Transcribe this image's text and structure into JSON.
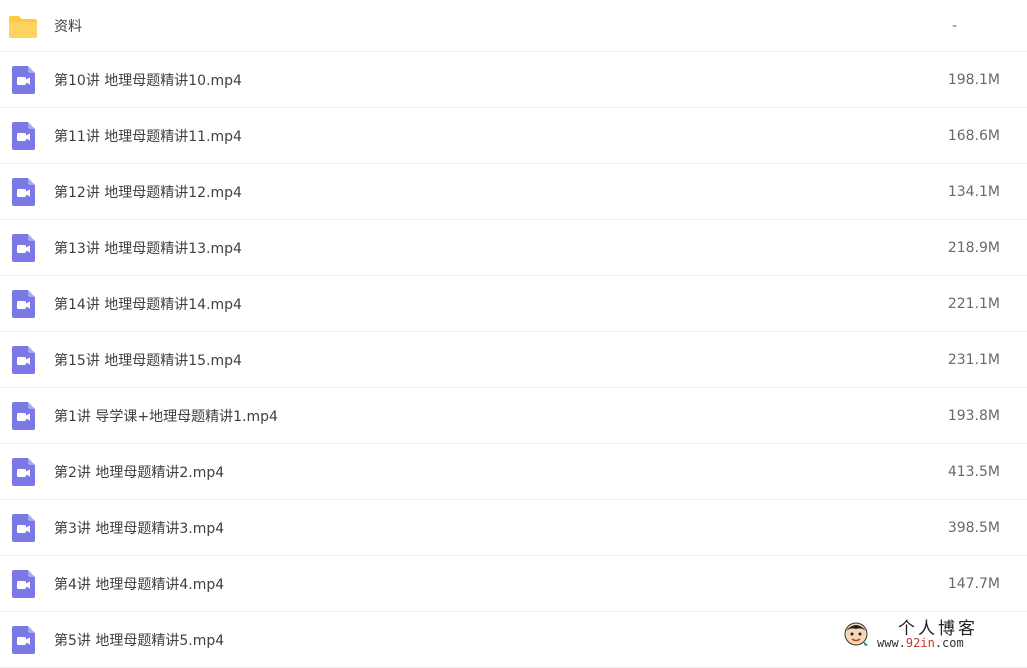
{
  "colors": {
    "folder": "#FFC940",
    "video_icon": "#7B79E8"
  },
  "files": [
    {
      "type": "folder",
      "icon": "folder-icon",
      "name": "资料",
      "size": "-"
    },
    {
      "type": "video",
      "icon": "video-file-icon",
      "name": "第10讲 地理母题精讲10.mp4",
      "size": "198.1M"
    },
    {
      "type": "video",
      "icon": "video-file-icon",
      "name": "第11讲 地理母题精讲11.mp4",
      "size": "168.6M"
    },
    {
      "type": "video",
      "icon": "video-file-icon",
      "name": "第12讲 地理母题精讲12.mp4",
      "size": "134.1M"
    },
    {
      "type": "video",
      "icon": "video-file-icon",
      "name": "第13讲 地理母题精讲13.mp4",
      "size": "218.9M"
    },
    {
      "type": "video",
      "icon": "video-file-icon",
      "name": "第14讲 地理母题精讲14.mp4",
      "size": "221.1M"
    },
    {
      "type": "video",
      "icon": "video-file-icon",
      "name": "第15讲 地理母题精讲15.mp4",
      "size": "231.1M"
    },
    {
      "type": "video",
      "icon": "video-file-icon",
      "name": "第1讲 导学课+地理母题精讲1.mp4",
      "size": "193.8M"
    },
    {
      "type": "video",
      "icon": "video-file-icon",
      "name": "第2讲 地理母题精讲2.mp4",
      "size": "413.5M"
    },
    {
      "type": "video",
      "icon": "video-file-icon",
      "name": "第3讲 地理母题精讲3.mp4",
      "size": "398.5M"
    },
    {
      "type": "video",
      "icon": "video-file-icon",
      "name": "第4讲 地理母题精讲4.mp4",
      "size": "147.7M"
    },
    {
      "type": "video",
      "icon": "video-file-icon",
      "name": "第5讲 地理母题精讲5.mp4",
      "size": ""
    }
  ],
  "watermark": {
    "title": "个人博客",
    "url_prefix": "www.",
    "url_highlight": "92in",
    "url_suffix": ".com"
  }
}
